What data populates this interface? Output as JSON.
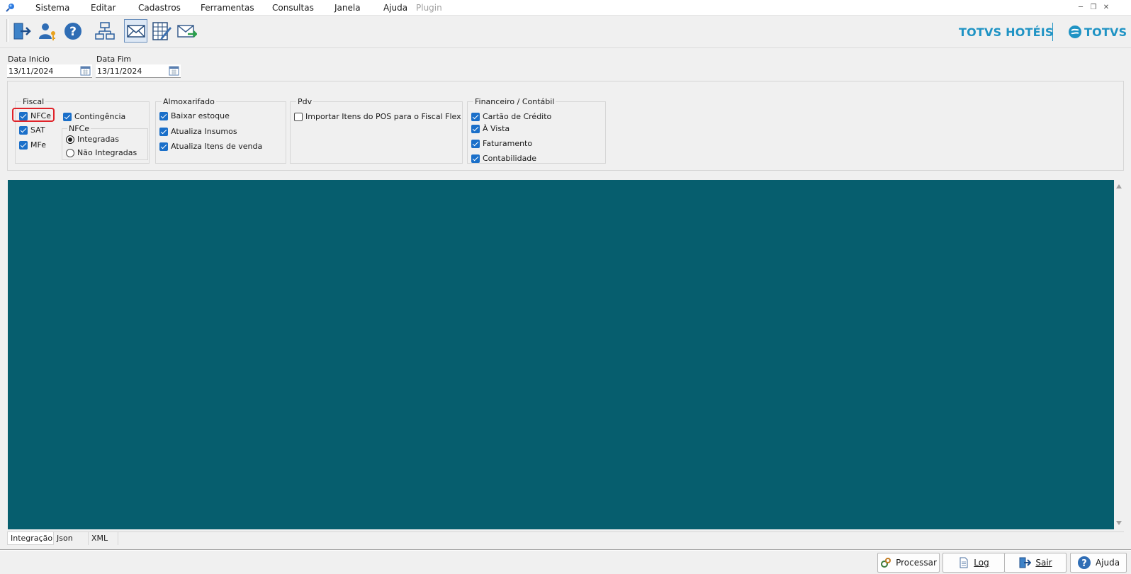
{
  "menu": {
    "items": [
      "Sistema",
      "Editar",
      "Cadastros",
      "Ferramentas",
      "Consultas",
      "Janela",
      "Ajuda"
    ],
    "plugin": "Plugin"
  },
  "toolbar": {
    "buttons": [
      {
        "icon": "exit-door-icon"
      },
      {
        "icon": "user-key-icon"
      },
      {
        "icon": "help-icon"
      },
      {
        "icon": "org-chart-icon"
      },
      {
        "icon": "envelope-icon",
        "active": true
      },
      {
        "icon": "spreadsheet-edit-icon"
      },
      {
        "icon": "envelope-send-icon"
      }
    ]
  },
  "brand": {
    "hoteis": "TOTVS HOTÉIS",
    "totvs": "TOTVS",
    "color": "#1f93c4"
  },
  "dates": {
    "inicio_label": "Data Inicio",
    "inicio_value": "13/11/2024",
    "fim_label": "Data Fim",
    "fim_value": "13/11/2024"
  },
  "fiscal": {
    "title": "Fiscal",
    "nfce": "NFCe",
    "sat": "SAT",
    "mfe": "MFe",
    "contingencia": "Contingência",
    "nfce_group_title": "NFCe",
    "integradas": "Integradas",
    "nao_integradas": "Não Integradas"
  },
  "almoxarifado": {
    "title": "Almoxarifado",
    "baixar_estoque": "Baixar estoque",
    "atualiza_insumos": "Atualiza Insumos",
    "atualiza_itens": "Atualiza Itens de venda"
  },
  "pdv": {
    "title": "Pdv",
    "importar": "Importar Itens do POS para o Fiscal Flex"
  },
  "financeiro": {
    "title": "Financeiro / Contábil",
    "cartao": "Cartão de Crédito",
    "a_vista": "À Vista",
    "faturamento": "Faturamento",
    "contabilidade": "Contabilidade"
  },
  "content": {
    "background": "#065e6e"
  },
  "tabs": [
    "Integração",
    "Json",
    "XML"
  ],
  "footer": {
    "processar": "Processar",
    "log": "Log",
    "sair": "Sair",
    "ajuda": "Ajuda"
  }
}
